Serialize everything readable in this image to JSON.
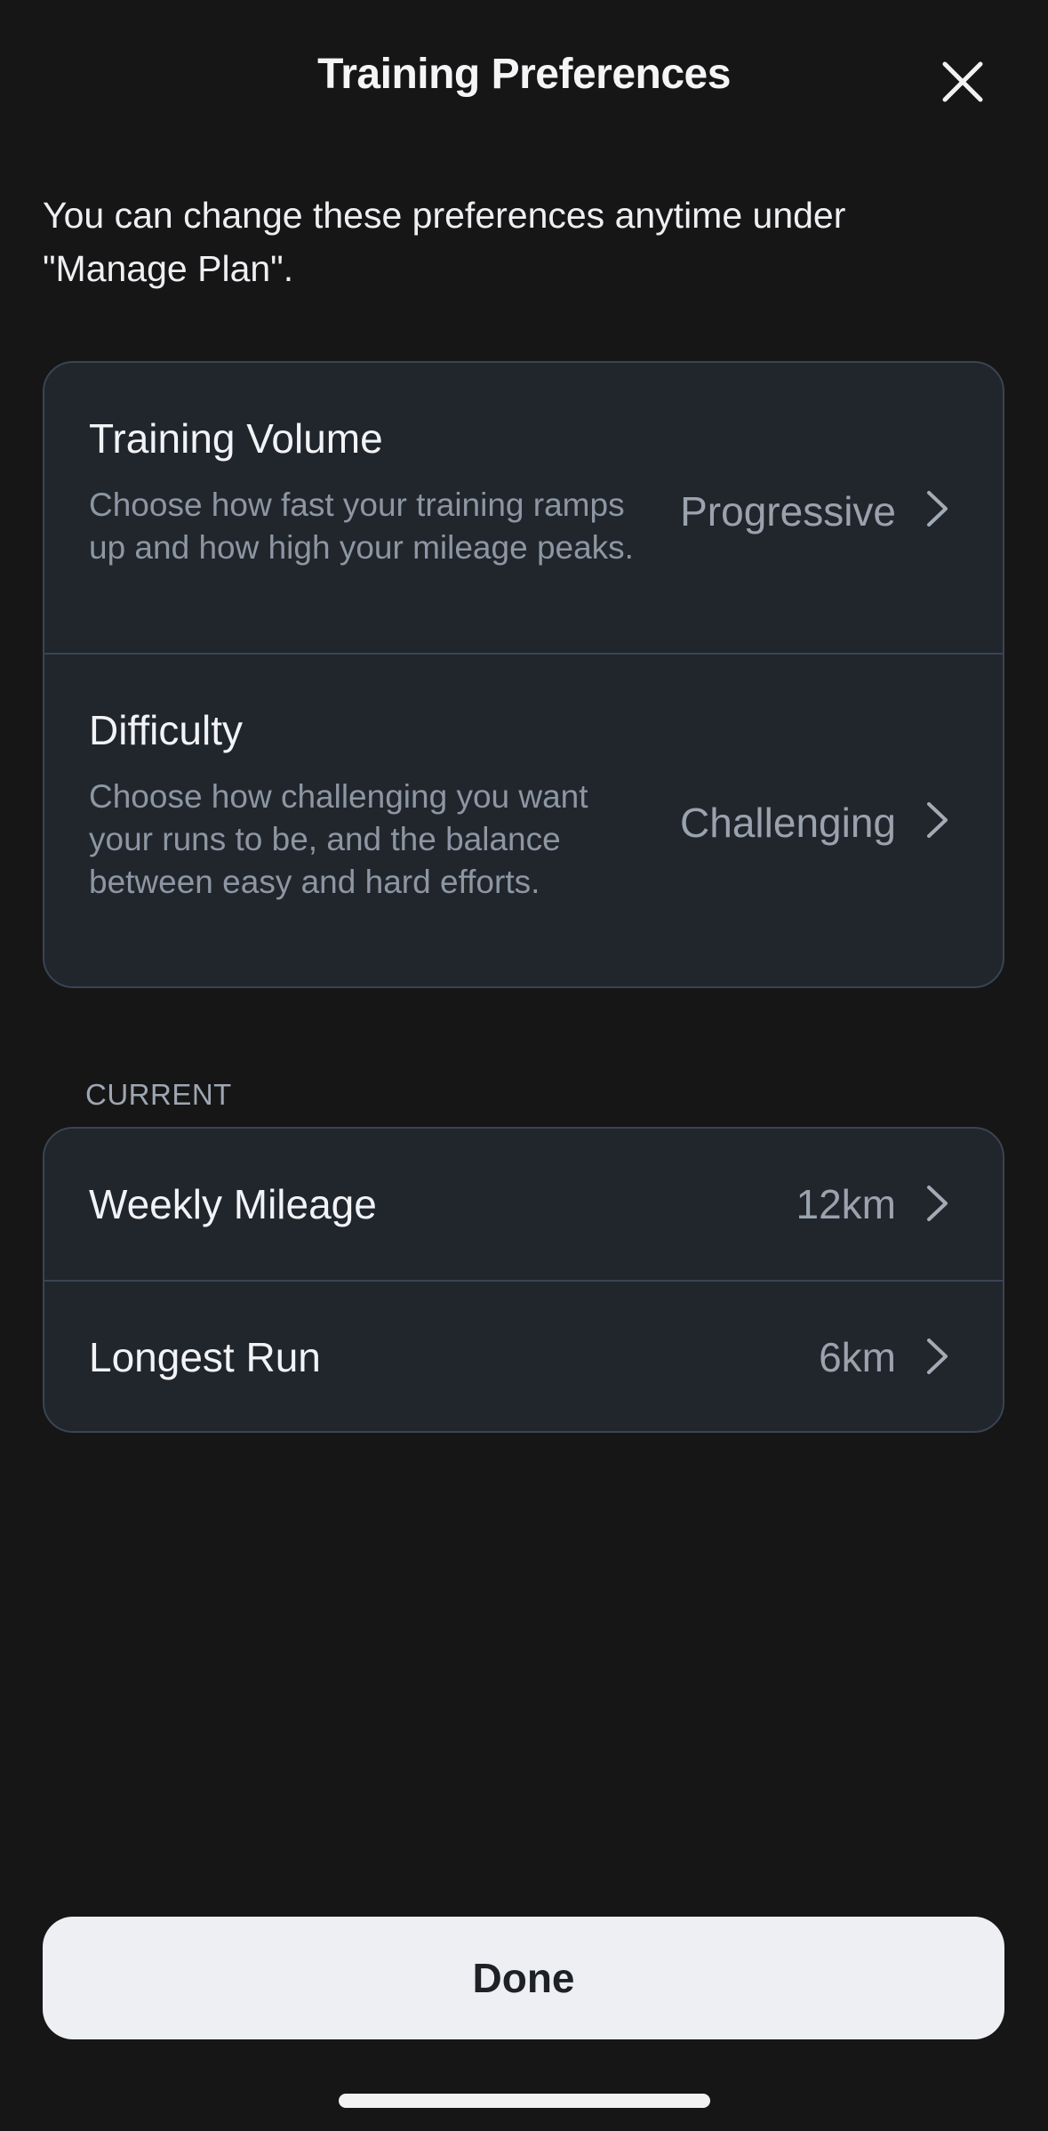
{
  "header": {
    "title": "Training Preferences",
    "close_icon": "close-icon"
  },
  "intro_text": "You can change these preferences anytime under \"Manage Plan\".",
  "preferences": {
    "training_volume": {
      "title": "Training Volume",
      "description": "Choose how fast your training ramps up and how high your mileage peaks.",
      "value": "Progressive"
    },
    "difficulty": {
      "title": "Difficulty",
      "description": "Choose how challenging you want your runs to be, and the balance between easy and hard efforts.",
      "value": "Challenging"
    }
  },
  "current": {
    "section_label": "CURRENT",
    "weekly_mileage": {
      "title": "Weekly Mileage",
      "value": "12km"
    },
    "longest_run": {
      "title": "Longest Run",
      "value": "6km"
    }
  },
  "footer": {
    "done_label": "Done"
  },
  "colors": {
    "background": "#161616",
    "card": "#21262c",
    "card_border": "#3a4453",
    "muted_text": "#8d96a3",
    "button_bg": "#eeeff2"
  }
}
